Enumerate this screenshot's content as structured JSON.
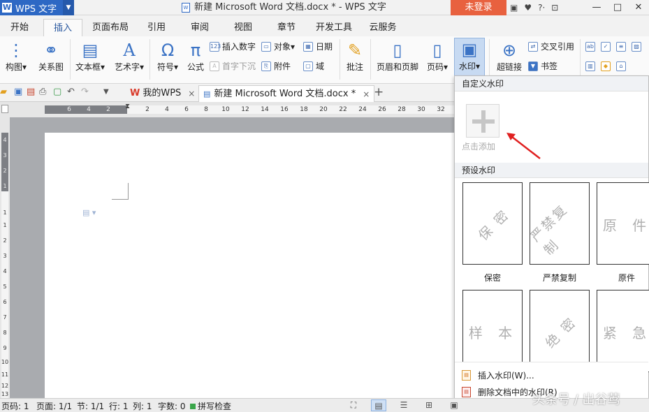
{
  "titlebar": {
    "app_name": "WPS 文字",
    "logo_letter": "W",
    "document_title": "新建 Microsoft Word 文档.docx * - WPS 文字",
    "login_label": "未登录",
    "help_label": "?·",
    "window_controls": [
      "—",
      "□",
      "✕"
    ]
  },
  "menu": {
    "tabs": [
      "开始",
      "插入",
      "页面布局",
      "引用",
      "审阅",
      "视图",
      "章节",
      "开发工具",
      "云服务"
    ],
    "active": "插入"
  },
  "ribbon": {
    "diagram": "构图",
    "relation_graph": "关系图",
    "textbox": "文本框",
    "wordart": "艺术字",
    "symbol": "符号",
    "formula": "公式",
    "insert_number": "插入数字",
    "drop_cap": "首字下沉",
    "object": "对象",
    "attachment": "附件",
    "date": "日期",
    "field": "域",
    "comment": "批注",
    "header_footer": "页眉和页脚",
    "page_number": "页码",
    "watermark": "水印",
    "hyperlink": "超链接",
    "cross_reference": "交叉引用",
    "bookmark": "书签"
  },
  "tabbar": {
    "tabs": [
      {
        "label": "我的WPS",
        "close": "×"
      },
      {
        "label": "新建 Microsoft Word 文档.docx *",
        "close": "×"
      }
    ],
    "new_tab": "+"
  },
  "ruler": {
    "ticks": [
      "6",
      "4",
      "2",
      "2",
      "4",
      "6",
      "8",
      "10",
      "12",
      "14",
      "16",
      "18",
      "20",
      "22",
      "24",
      "26",
      "28",
      "30",
      "32"
    ],
    "left_ticks": [
      "4",
      "3",
      "2",
      "1",
      "1",
      "1",
      "2",
      "3",
      "4",
      "5",
      "6",
      "7",
      "8",
      "9",
      "10",
      "11",
      "12",
      "13"
    ]
  },
  "watermark_panel": {
    "custom_header": "自定义水印",
    "add_label": "点击添加",
    "preset_header": "预设水印",
    "presets": [
      {
        "text": "保 密",
        "label": "保密",
        "diagonal": true
      },
      {
        "text": "严禁复制",
        "label": "严禁复制",
        "diagonal": true
      },
      {
        "text": "原 件",
        "label": "原件",
        "diagonal": false
      },
      {
        "text": "样 本",
        "label": "",
        "diagonal": false
      },
      {
        "text": "绝 密",
        "label": "",
        "diagonal": true
      },
      {
        "text": "紧 急",
        "label": "",
        "diagonal": false
      }
    ],
    "insert_watermark": "插入水印(W)...",
    "delete_watermark": "删除文档中的水印(R)"
  },
  "statusbar": {
    "page_num": "页码: 1",
    "pages": "页面: 1/1",
    "section": "节: 1/1",
    "row": "行: 1",
    "col": "列: 1",
    "words": "字数: 0",
    "spell": "拼写检查"
  },
  "source_mark": "头条号 / 出谷莺"
}
